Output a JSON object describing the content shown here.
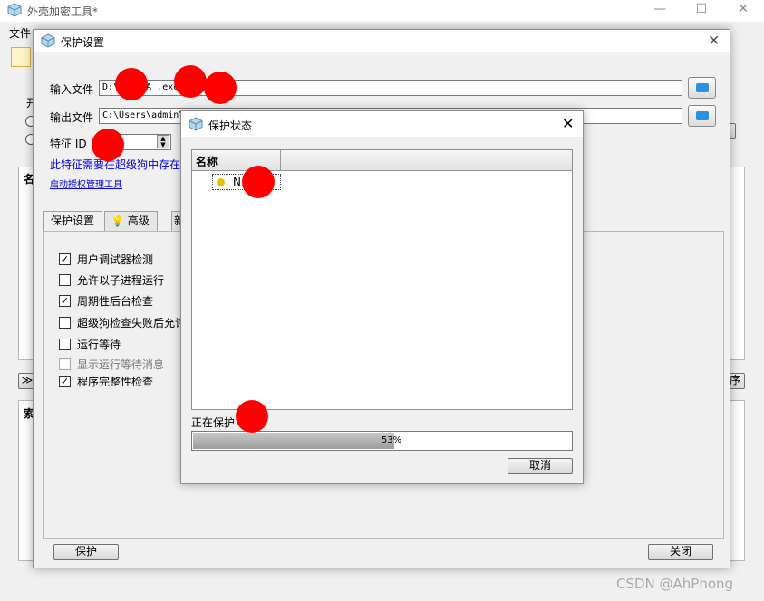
{
  "app": {
    "title": "外壳加密工具*",
    "menu_file": "文件",
    "side_open_label": "开",
    "side_list_header": "名",
    "side_index_header": "索",
    "side_left_button": "≫",
    "side_right_button": "序"
  },
  "protect_dialog": {
    "title": "保护设置",
    "input_label": "输入文件",
    "input_value": "D:\\    D1\\NA        .exe",
    "output_label": "输出文件",
    "output_value": "C:\\Users\\admin\\",
    "feature_label": "特征 ID",
    "feature_note": "此特征需要在超级狗中存在",
    "auth_link": "启动授权管理工具",
    "tabs": [
      "保护设置",
      "高级",
      "新"
    ],
    "options": [
      {
        "label": "用户调试器检测",
        "checked": true,
        "disabled": false
      },
      {
        "label": "允许以子进程运行",
        "checked": false,
        "disabled": false
      },
      {
        "label": "周期性后台检查",
        "checked": true,
        "disabled": false
      },
      {
        "label": "超级狗检查失败后允许",
        "checked": false,
        "disabled": false
      },
      {
        "label": "运行等待",
        "checked": false,
        "disabled": false
      },
      {
        "label": "显示运行等待消息",
        "checked": false,
        "disabled": true
      },
      {
        "label": "程序完整性检查",
        "checked": true,
        "disabled": false
      }
    ],
    "protect_button": "保护",
    "close_button": "关闭"
  },
  "status_dialog": {
    "title": "保护状态",
    "column_name": "名称",
    "item_label": "N        4",
    "status_text": "正在保护",
    "progress": 53,
    "progress_text": "53%",
    "cancel_button": "取消"
  },
  "watermark": "CSDN @AhPhong",
  "colors": {
    "accent": "#2f8fe0",
    "redaction": "#ff0000"
  }
}
